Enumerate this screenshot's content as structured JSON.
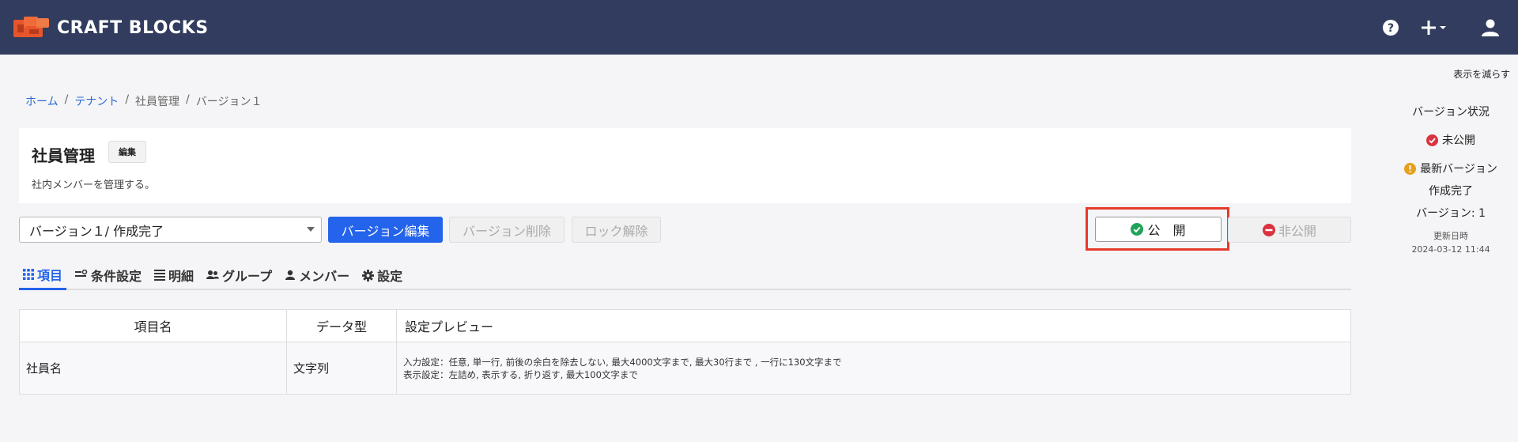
{
  "header": {
    "logo_text": "CRAFT BLOCKS",
    "icons": [
      "help-icon",
      "plus-icon",
      "user-icon"
    ]
  },
  "collapse_link": "表示を減らす",
  "breadcrumb": {
    "items": [
      {
        "label": "ホーム",
        "link": true
      },
      {
        "label": "テナント",
        "link": true
      },
      {
        "label": "社員管理",
        "link": false
      },
      {
        "label": "バージョン１",
        "link": false
      }
    ],
    "separator": "/"
  },
  "page": {
    "title": "社員管理",
    "edit_badge": "編集",
    "description": "社内メンバーを管理する。"
  },
  "toolbar": {
    "version_select": "バージョン１/ 作成完了",
    "version_edit": "バージョン編集",
    "version_delete": "バージョン削除",
    "unlock": "ロック解除",
    "publish": "公　開",
    "unpublish": "非公開"
  },
  "tabs": [
    {
      "label": "項目",
      "icon": "grid-icon",
      "active": true
    },
    {
      "label": "条件設定",
      "icon": "condition-icon",
      "active": false
    },
    {
      "label": "明細",
      "icon": "list-icon",
      "active": false
    },
    {
      "label": "グループ",
      "icon": "group-icon",
      "active": false
    },
    {
      "label": "メンバー",
      "icon": "person-icon",
      "active": false
    },
    {
      "label": "設定",
      "icon": "gear-icon",
      "active": false
    }
  ],
  "table": {
    "headers": [
      "項目名",
      "データ型",
      "設定プレビュー"
    ],
    "rows": [
      {
        "name": "社員名",
        "type": "文字列",
        "preview_input": "入力設定：任意, 単一行, 前後の余白を除去しない, 最大4000文字まで, 最大30行まで , 一行に130文字まで",
        "preview_display": "表示設定：左詰め, 表示する, 折り返す, 最大100文字まで"
      }
    ]
  },
  "status_panel": {
    "title": "バージョン状況",
    "status": "未公開",
    "latest_label": "最新バージョン",
    "latest_state": "作成完了",
    "version": "バージョン: 1",
    "updated_label": "更新日時",
    "updated_at": "2024-03-12 11:44"
  },
  "colors": {
    "topbar": "#313c5e",
    "primary": "#2463eb",
    "highlight": "#e53b2c",
    "status_red": "#d9333f",
    "status_warn": "#e4a11b",
    "publish_green": "#21a35a"
  }
}
